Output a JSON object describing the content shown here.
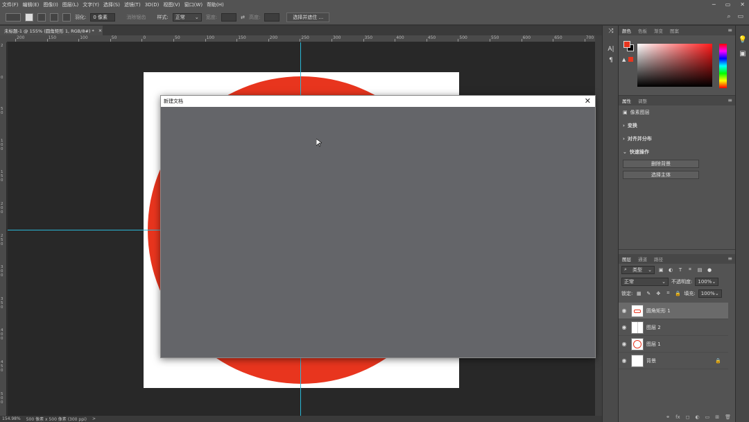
{
  "menu": [
    "文件(F)",
    "编辑(E)",
    "图像(I)",
    "图层(L)",
    "文字(Y)",
    "选择(S)",
    "滤镜(T)",
    "3D(D)",
    "视图(V)",
    "窗口(W)",
    "帮助(H)"
  ],
  "window_controls": [
    "─",
    "▭",
    "✕"
  ],
  "options_bar": {
    "feather_label": "羽化:",
    "feather_value": "0 像素",
    "antialias_label": "消除锯齿",
    "style_label": "样式:",
    "style_value": "正常",
    "width_label": "宽度:",
    "height_label": "高度:",
    "select_mask_button": "选择并遮住 ..."
  },
  "document_tab": {
    "title": "未标题-1 @ 155% (圆角矩形 1, RGB/8#) *",
    "close": "×"
  },
  "ruler_top_labels": [
    "200",
    "150",
    "100",
    "50",
    "0",
    "50",
    "100",
    "150",
    "200",
    "250",
    "300",
    "350",
    "400",
    "450",
    "500",
    "550",
    "600",
    "650",
    "700"
  ],
  "ruler_left_labels": [
    "2",
    "0",
    "5 0",
    "1 0 0",
    "1 5 0",
    "2 0 0",
    "2 5 0",
    "3 0 0",
    "3 5 0",
    "4 0 0",
    "4 5 0",
    "5 0 0"
  ],
  "status_bar": {
    "zoom": "154.98%",
    "doc_size": "500 像素 x 500 像素 (300 ppi)",
    "arrow": ">"
  },
  "dialog": {
    "title": "新建文档",
    "close": "✕"
  },
  "color_panel": {
    "tabs": [
      "颜色",
      "色板",
      "渐变",
      "图案"
    ],
    "foreground": "#e8351e",
    "background": "#000000"
  },
  "properties_panel": {
    "tabs": [
      "属性",
      "调整"
    ],
    "layer_type": "像素图层",
    "sections": [
      "变换",
      "对齐并分布",
      "快速操作"
    ],
    "buttons": [
      "删除背景",
      "选择主体"
    ]
  },
  "layers_panel": {
    "tabs": [
      "图层",
      "通道",
      "路径"
    ],
    "filter_label": "类型",
    "blend_mode": "正常",
    "opacity_label": "不透明度:",
    "opacity_value": "100%",
    "lock_label": "锁定:",
    "fill_label": "填充:",
    "fill_value": "100%",
    "layers": [
      {
        "name": "圆角矩形 1",
        "selected": true
      },
      {
        "name": "图层 2",
        "selected": false
      },
      {
        "name": "图层 1",
        "selected": false
      },
      {
        "name": "背景",
        "selected": false
      }
    ],
    "bottom_icons": [
      "⚭",
      "fx",
      "◻",
      "◐",
      "▭",
      "⊞",
      "🗑"
    ]
  },
  "colors": {
    "accent_red": "#e8351e",
    "guide": "#2ab8d8",
    "dialog_bg": "#646569"
  }
}
